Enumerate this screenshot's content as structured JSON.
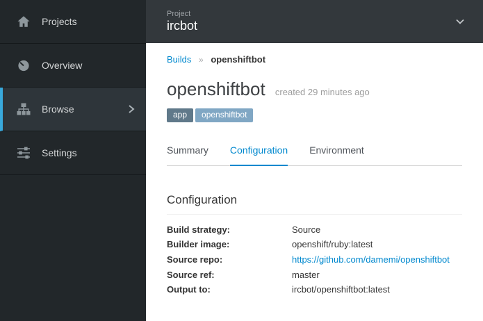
{
  "sidebar": {
    "items": [
      {
        "label": "Projects",
        "icon": "home-icon",
        "active": false
      },
      {
        "label": "Overview",
        "icon": "tachometer-icon",
        "active": false
      },
      {
        "label": "Browse",
        "icon": "sitemap-icon",
        "active": true
      },
      {
        "label": "Settings",
        "icon": "sliders-icon",
        "active": false
      }
    ]
  },
  "header": {
    "context_label": "Project",
    "project_name": "ircbot"
  },
  "breadcrumb": {
    "items": [
      {
        "label": "Builds"
      },
      {
        "label": "openshiftbot"
      }
    ],
    "separator": "»"
  },
  "page": {
    "title": "openshiftbot",
    "created_text": "created 29 minutes ago",
    "labels": [
      {
        "key": "app",
        "value": "openshiftbot"
      }
    ]
  },
  "tabs": [
    {
      "label": "Summary",
      "active": false
    },
    {
      "label": "Configuration",
      "active": true
    },
    {
      "label": "Environment",
      "active": false
    }
  ],
  "configuration": {
    "heading": "Configuration",
    "rows": [
      {
        "label": "Build strategy:",
        "value": "Source"
      },
      {
        "label": "Builder image:",
        "value": "openshift/ruby:latest"
      },
      {
        "label": "Source repo:",
        "value": "https://github.com/damemi/openshiftbot",
        "is_link": true
      },
      {
        "label": "Source ref:",
        "value": "master"
      },
      {
        "label": "Output to:",
        "value": "ircbot/openshiftbot:latest"
      }
    ]
  },
  "colors": {
    "accent": "#0088ce",
    "sidebar_bg": "#22272a",
    "sidebar_active_border": "#39a9dc",
    "topbar_bg": "#33383c",
    "label_key_bg": "#60798a",
    "label_value_bg": "#80a7c4"
  }
}
